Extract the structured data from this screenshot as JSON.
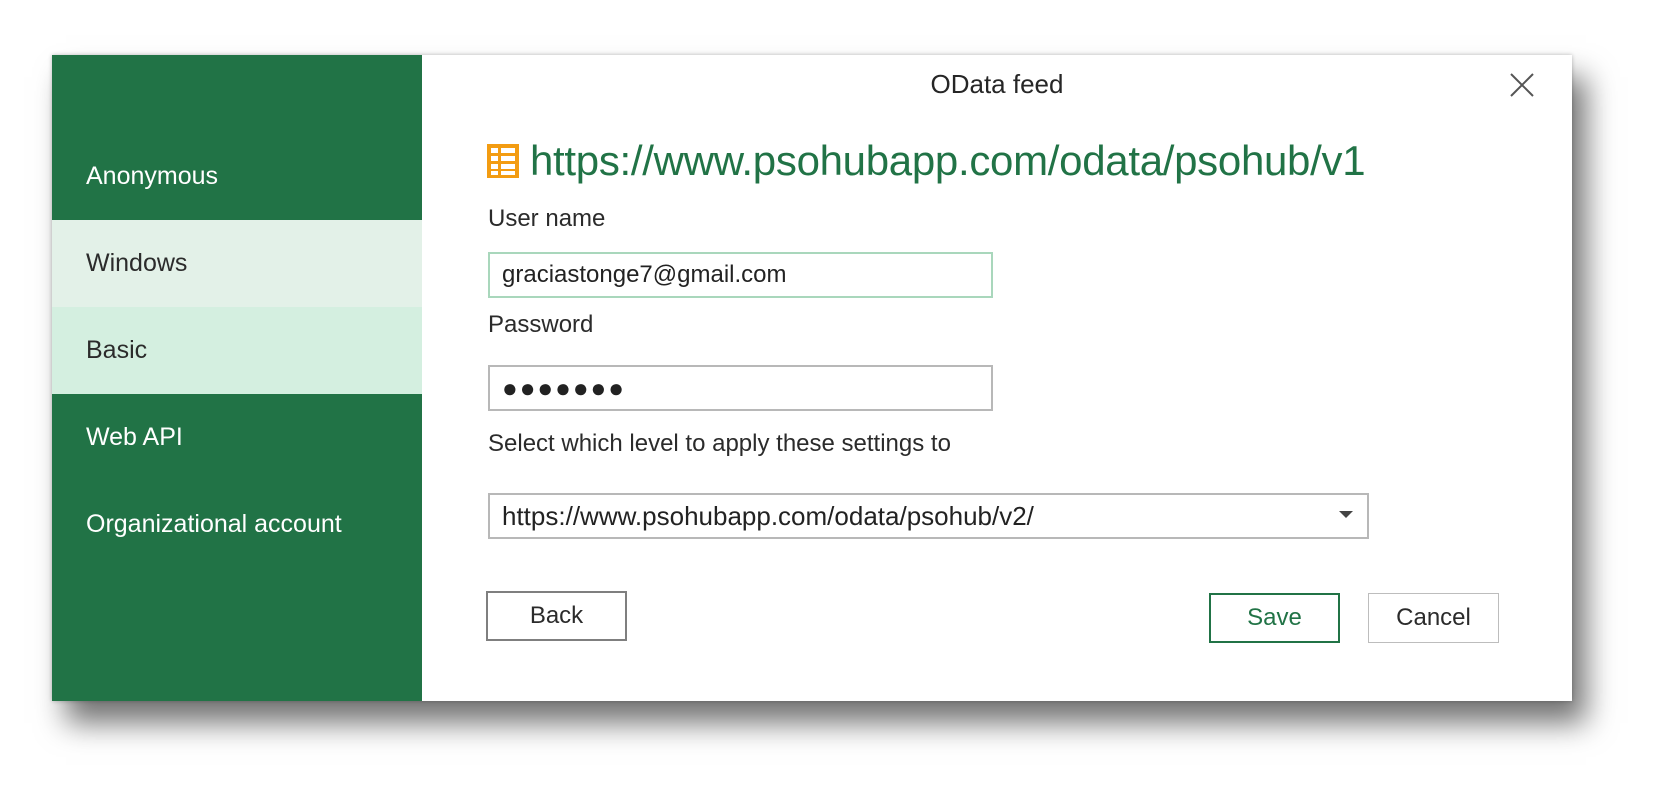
{
  "dialog": {
    "title": "OData feed",
    "close_icon": "close-icon"
  },
  "sidebar": {
    "items": [
      {
        "label": "Anonymous",
        "state": "default"
      },
      {
        "label": "Windows",
        "state": "hover"
      },
      {
        "label": "Basic",
        "state": "selected"
      },
      {
        "label": "Web API",
        "state": "default"
      },
      {
        "label": "Organizational account",
        "state": "default"
      }
    ]
  },
  "source": {
    "icon": "odata-table-icon",
    "url": "https://www.psohubapp.com/odata/psohub/v1"
  },
  "form": {
    "username_label": "User name",
    "username_value": "graciastonge7@gmail.com",
    "password_label": "Password",
    "password_value": "●●●●●●●",
    "level_label": "Select which level to apply these settings to",
    "level_value": "https://www.psohubapp.com/odata/psohub/v2/"
  },
  "buttons": {
    "back": "Back",
    "save": "Save",
    "cancel": "Cancel"
  },
  "colors": {
    "sidebar_bg": "#217346",
    "accent": "#217346",
    "selected_bg": "#d4efe0",
    "hover_bg": "#e3f1e8",
    "icon_orange": "#f39c12"
  }
}
